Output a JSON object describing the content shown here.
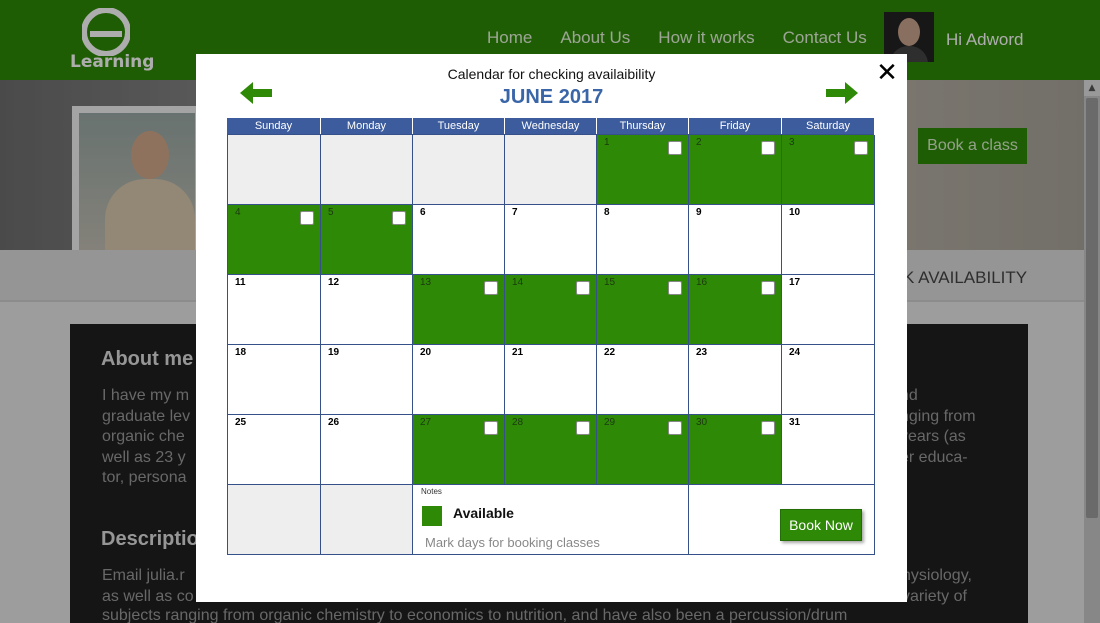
{
  "header": {
    "logo_text": "Learning",
    "nav": [
      "Home",
      "About Us",
      "How it works",
      "Contact Us"
    ],
    "greeting": "Hi Adword"
  },
  "profile": {
    "book_class_label": "Book a class",
    "availability_tab": "K AVAILABILITY",
    "about_title": "About me",
    "about_lines_left": [
      "I have my m",
      "graduate lev",
      "organic che",
      "well as 23 y",
      "tor, persona"
    ],
    "about_lines_right": [
      "nd",
      "nging from",
      "years (as",
      "er educa-"
    ],
    "description_title": "Descriptio",
    "desc_lines_left": [
      "Email julia.r",
      "as well as co"
    ],
    "desc_lines_right": [
      "hysiology,",
      "variety of"
    ],
    "desc_bottom": "subjects ranging from organic chemistry to economics to nutrition, and have also been a percussion/drum"
  },
  "modal": {
    "heading": "Calendar for checking availaibility",
    "month": "JUNE 2017",
    "weekdays": [
      "Sunday",
      "Monday",
      "Tuesday",
      "Wednesday",
      "Thursday",
      "Friday",
      "Saturday"
    ],
    "days": [
      {
        "n": "",
        "s": "empty"
      },
      {
        "n": "",
        "s": "empty"
      },
      {
        "n": "",
        "s": "empty"
      },
      {
        "n": "",
        "s": "empty"
      },
      {
        "n": "1",
        "s": "avail"
      },
      {
        "n": "2",
        "s": "avail"
      },
      {
        "n": "3",
        "s": "avail"
      },
      {
        "n": "4",
        "s": "avail"
      },
      {
        "n": "5",
        "s": "avail"
      },
      {
        "n": "6",
        "s": ""
      },
      {
        "n": "7",
        "s": ""
      },
      {
        "n": "8",
        "s": ""
      },
      {
        "n": "9",
        "s": ""
      },
      {
        "n": "10",
        "s": ""
      },
      {
        "n": "11",
        "s": ""
      },
      {
        "n": "12",
        "s": ""
      },
      {
        "n": "13",
        "s": "avail"
      },
      {
        "n": "14",
        "s": "avail"
      },
      {
        "n": "15",
        "s": "avail"
      },
      {
        "n": "16",
        "s": "avail"
      },
      {
        "n": "17",
        "s": ""
      },
      {
        "n": "18",
        "s": ""
      },
      {
        "n": "19",
        "s": ""
      },
      {
        "n": "20",
        "s": ""
      },
      {
        "n": "21",
        "s": ""
      },
      {
        "n": "22",
        "s": ""
      },
      {
        "n": "23",
        "s": ""
      },
      {
        "n": "24",
        "s": ""
      },
      {
        "n": "25",
        "s": ""
      },
      {
        "n": "26",
        "s": ""
      },
      {
        "n": "27",
        "s": "avail"
      },
      {
        "n": "28",
        "s": "avail"
      },
      {
        "n": "29",
        "s": "avail"
      },
      {
        "n": "30",
        "s": "avail"
      },
      {
        "n": "31",
        "s": ""
      }
    ],
    "notes_label": "Notes",
    "legend_label": "Available",
    "hint": "Mark days for booking classes",
    "book_now_label": "Book Now"
  },
  "colors": {
    "brand_green": "#2e8a06",
    "header_blue": "#3c5c9e",
    "month_blue": "#3a66a8"
  }
}
